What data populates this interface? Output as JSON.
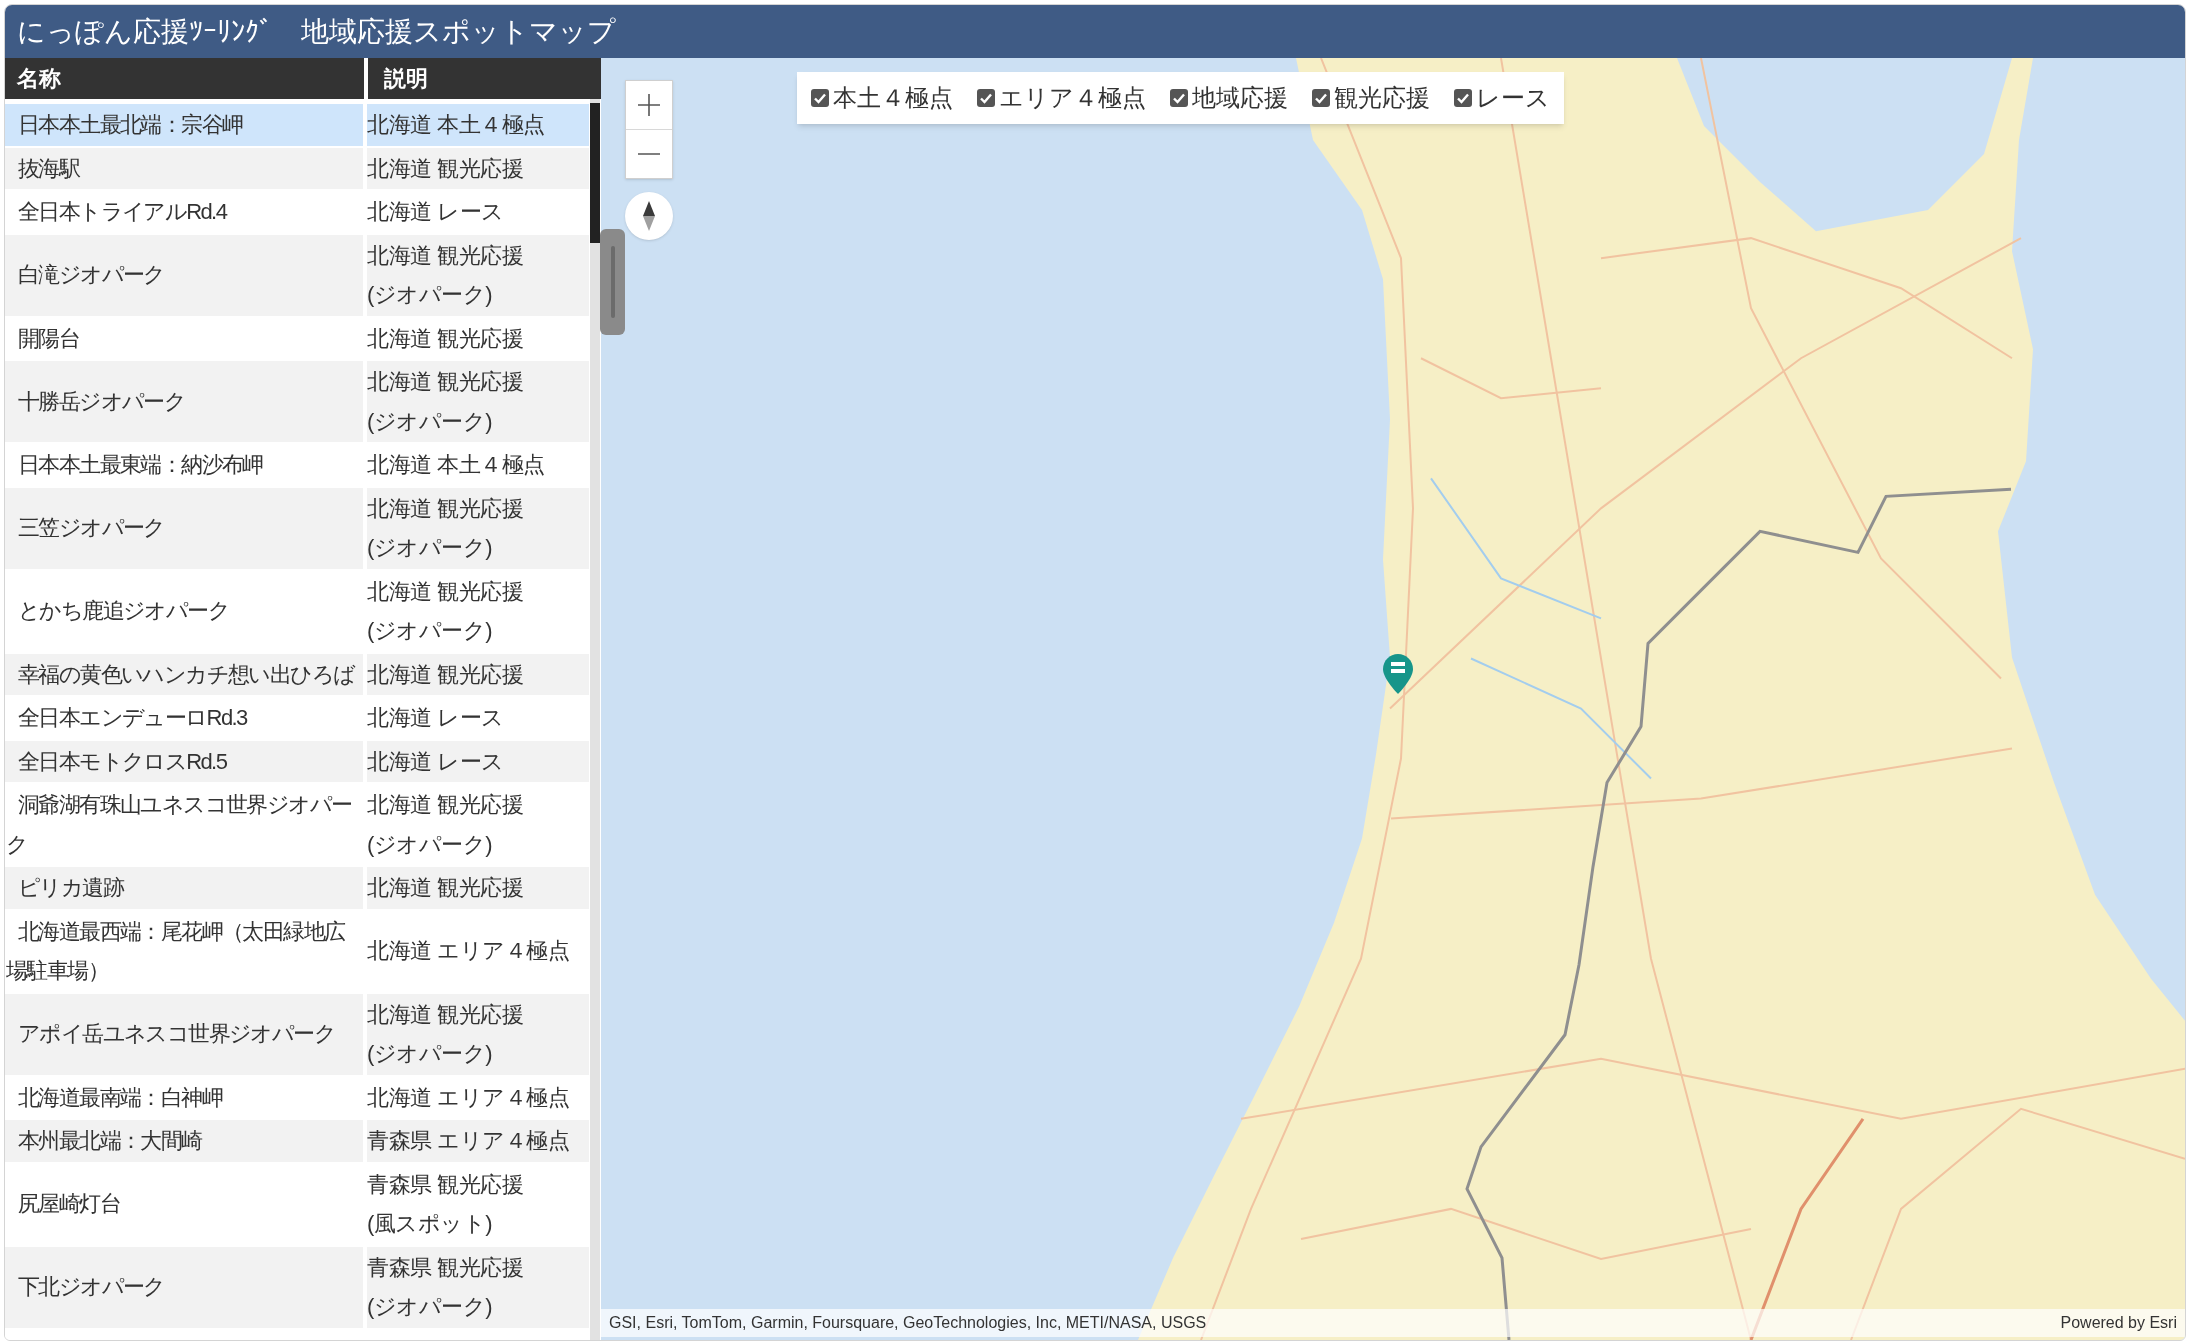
{
  "header": {
    "title": "にっぽん応援ﾂｰﾘﾝｸﾞ　地域応援スポットマップ"
  },
  "table": {
    "columns": [
      "名称",
      "説明"
    ],
    "rows": [
      {
        "name": "日本本土最北端：宗谷岬",
        "description": "北海道 本土４極点",
        "selected": true
      },
      {
        "name": "抜海駅",
        "description": "北海道 観光応援",
        "selected": false
      },
      {
        "name": "全日本トライアルRd.4",
        "description": "北海道 レース",
        "selected": false
      },
      {
        "name": "白滝ジオパーク",
        "description": "北海道 観光応援\n(ジオパーク)",
        "selected": false
      },
      {
        "name": "開陽台",
        "description": "北海道 観光応援",
        "selected": false
      },
      {
        "name": "十勝岳ジオパーク",
        "description": "北海道 観光応援\n(ジオパーク)",
        "selected": false
      },
      {
        "name": "日本本土最東端：納沙布岬",
        "description": "北海道 本土４極点",
        "selected": false
      },
      {
        "name": "三笠ジオパーク",
        "description": "北海道 観光応援\n(ジオパーク)",
        "selected": false
      },
      {
        "name": "とかち鹿追ジオパーク",
        "description": "北海道 観光応援\n(ジオパーク)",
        "selected": false
      },
      {
        "name": "幸福の黄色いハンカチ想い出ひろば",
        "description": "北海道 観光応援",
        "selected": false
      },
      {
        "name": "全日本エンデューロRd.3",
        "description": "北海道 レース",
        "selected": false
      },
      {
        "name": "全日本モトクロスRd.5",
        "description": "北海道 レース",
        "selected": false
      },
      {
        "name": "洞爺湖有珠山ユネスコ世界ジオパーク",
        "description": "北海道 観光応援\n(ジオパーク)",
        "selected": false
      },
      {
        "name": "ピリカ遺跡",
        "description": "北海道 観光応援",
        "selected": false
      },
      {
        "name": "北海道最西端：尾花岬（太田緑地広場駐車場）",
        "description": "北海道 エリア４極点",
        "selected": false
      },
      {
        "name": "アポイ岳ユネスコ世界ジオパーク",
        "description": "北海道 観光応援\n(ジオパーク)",
        "selected": false
      },
      {
        "name": "北海道最南端：白神岬",
        "description": "北海道 エリア４極点",
        "selected": false
      },
      {
        "name": "本州最北端：大間崎",
        "description": "青森県 エリア４極点",
        "selected": false
      },
      {
        "name": "尻屋崎灯台",
        "description": "青森県 観光応援\n(風スポット)",
        "selected": false
      },
      {
        "name": "下北ジオパーク",
        "description": "青森県 観光応援\n(ジオパーク)",
        "selected": false
      }
    ]
  },
  "map": {
    "layers": [
      {
        "label": "本土４極点",
        "checked": true
      },
      {
        "label": "エリア４極点",
        "checked": true
      },
      {
        "label": "地域応援",
        "checked": true
      },
      {
        "label": "観光応援",
        "checked": true
      },
      {
        "label": "レース",
        "checked": true
      }
    ],
    "attribution": "GSI, Esri, TomTom, Garmin, Foursquare, GeoTechnologies, Inc, METI/NASA, USGS",
    "powered_by": "Powered by Esri"
  }
}
